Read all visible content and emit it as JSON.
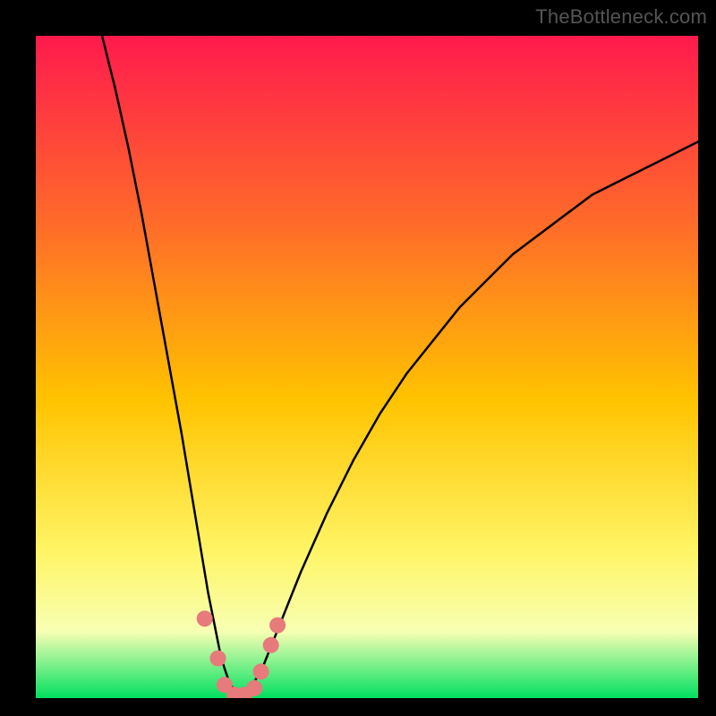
{
  "attribution": "TheBottleneck.com",
  "colors": {
    "frame": "#000000",
    "gradient_top": "#ff1a4d",
    "gradient_mid_upper": "#ff6a2a",
    "gradient_mid": "#ffc300",
    "gradient_mid_lower": "#fff566",
    "gradient_low_band": "#f7ffb3",
    "gradient_bottom": "#00e060",
    "curve": "#000000",
    "marker_fill": "#e77a7a",
    "marker_stroke": "#c24f4f"
  },
  "chart_data": {
    "type": "line",
    "title": "",
    "xlabel": "",
    "ylabel": "",
    "xlim": [
      0,
      100
    ],
    "ylim": [
      0,
      100
    ],
    "x": [
      10,
      12,
      14,
      16,
      18,
      20,
      22,
      24,
      26,
      27,
      28,
      29,
      30,
      31,
      32,
      34,
      36,
      38,
      40,
      44,
      48,
      52,
      56,
      60,
      64,
      68,
      72,
      76,
      80,
      84,
      88,
      92,
      96,
      100
    ],
    "y": [
      100,
      92,
      83,
      73,
      62,
      51,
      40,
      28,
      16,
      11,
      6,
      3,
      1,
      0,
      1,
      4,
      9,
      14,
      19,
      28,
      36,
      43,
      49,
      54,
      59,
      63,
      67,
      70,
      73,
      76,
      78,
      80,
      82,
      84
    ],
    "markers": [
      {
        "x": 25.5,
        "y": 12
      },
      {
        "x": 27.5,
        "y": 6
      },
      {
        "x": 28.5,
        "y": 2
      },
      {
        "x": 30.0,
        "y": 0.5
      },
      {
        "x": 31.5,
        "y": 0.5
      },
      {
        "x": 33.0,
        "y": 1.5
      },
      {
        "x": 34.0,
        "y": 4
      },
      {
        "x": 35.5,
        "y": 8
      },
      {
        "x": 36.5,
        "y": 11
      }
    ],
    "annotations": []
  }
}
